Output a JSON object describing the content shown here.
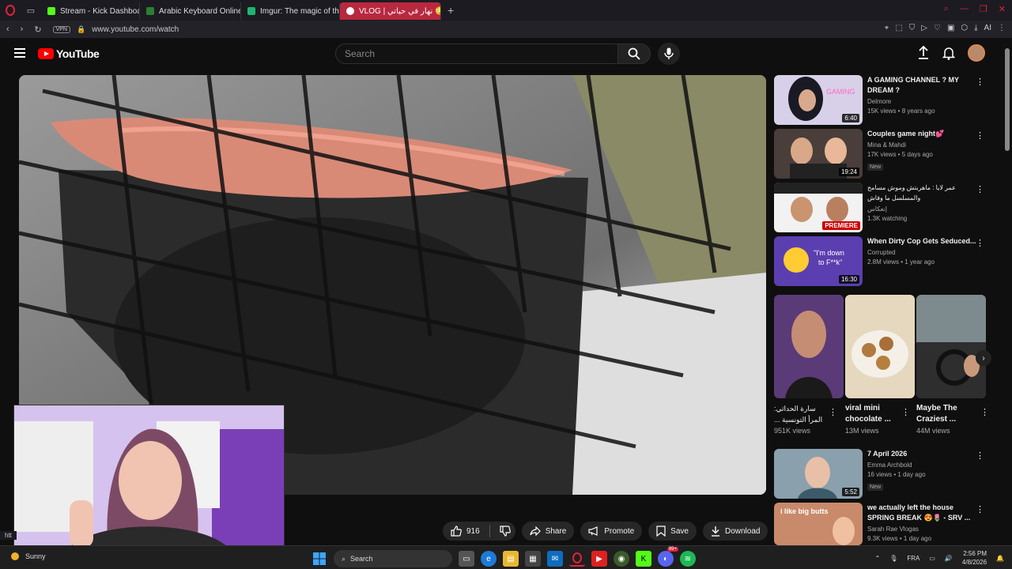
{
  "browser": {
    "tabs": [
      {
        "label": "Stream - Kick Dashboard",
        "color": "#53fc18",
        "glyph": "K"
      },
      {
        "label": "Arabic Keyboard Online -",
        "color": "#2e7d32",
        "glyph": "L"
      },
      {
        "label": "Imgur: The magic of the In",
        "color": "#1bb76e",
        "glyph": "i"
      },
      {
        "label": "VLOG | نهار في حياتي 😳 -",
        "color": "#ff0000",
        "glyph": "▶",
        "active": true
      }
    ],
    "address": {
      "vpn": "VPN",
      "url": "www.youtube.com/watch"
    },
    "status_url": "htt",
    "ai_label": "AI"
  },
  "youtube": {
    "logo_text": "YouTube",
    "search_placeholder": "Search"
  },
  "actions": {
    "likes": "916",
    "share": "Share",
    "promote": "Promote",
    "save": "Save",
    "download": "Download"
  },
  "sidebar": [
    {
      "title": "A GAMING CHANNEL ? MY DREAM ?",
      "channel": "Delmore",
      "views": "15K views • 8 years ago",
      "duration": "6:40",
      "thumb": "#2a1d3a"
    },
    {
      "title": "Couples game night💕",
      "channel": "Mina & Mahdi",
      "views": "17K views • 5 days ago",
      "duration": "19:24",
      "badge": "New",
      "thumb": "#3a3432"
    },
    {
      "title": "عمر لايا : ماهربتش وموش مسامح والمسلسل ما وفاش",
      "channel": "إنعكاس",
      "views": "1.3K watching",
      "premiere": "PREMIERE",
      "thumb": "#2d3a2e"
    },
    {
      "title": "When Dirty Cop Gets Seduced...",
      "channel": "Corrupted",
      "views": "2.8M views • 1 year ago",
      "duration": "16:30",
      "thumb": "#3b2b6a"
    }
  ],
  "shorts": [
    {
      "title": "سارة الحداثي: المرأ التونسية ...",
      "views": "951K views",
      "thumb": "#4a2f5a"
    },
    {
      "title": "viral mini chocolate ...",
      "views": "13M views",
      "thumb": "#c8b38a"
    },
    {
      "title": "Maybe The Craziest ...",
      "views": "44M views",
      "thumb": "#3e4a4d"
    }
  ],
  "sidebar_lower": [
    {
      "title": "7 April 2026",
      "channel": "Emma Archbold",
      "views": "16 views • 1 day ago",
      "duration": "5:52",
      "badge": "New",
      "thumb": "#6e8a9a"
    },
    {
      "title": "we actually left the house SPRING BREAK 😍🌷 - SRV ...",
      "channel": "Sarah Rae Vlogas",
      "views": "9.3K views • 1 day ago",
      "thumb": "#7a4a3a",
      "overlay": "i like big butts"
    }
  ],
  "taskbar": {
    "weather": "Sunny",
    "search": "Search",
    "lang": "FRA",
    "time": "2:56 PM",
    "date": "4/8/2026",
    "notif_badge": "99+"
  }
}
